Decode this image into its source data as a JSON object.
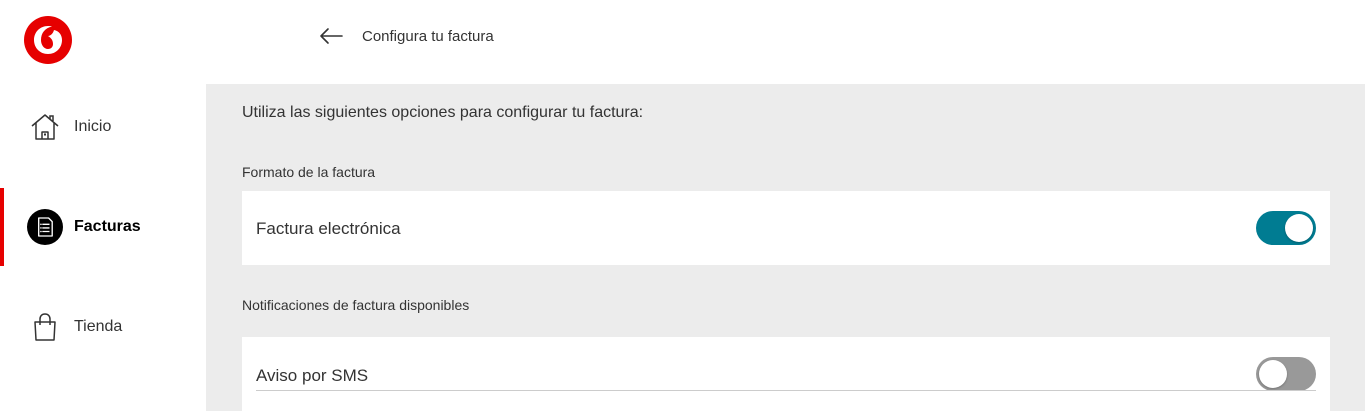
{
  "brand": {
    "color": "#e60000",
    "logo_icon": "vodafone-speechmark-icon"
  },
  "header": {
    "back_icon": "arrow-left-icon",
    "title": "Configura tu factura"
  },
  "sidebar": {
    "items": [
      {
        "label": "Inicio",
        "icon": "home-icon",
        "active": false
      },
      {
        "label": "Facturas",
        "icon": "bill-icon",
        "active": true
      },
      {
        "label": "Tienda",
        "icon": "shopping-bag-icon",
        "active": false
      }
    ]
  },
  "main": {
    "intro": "Utiliza las siguientes opciones para configurar tu factura:",
    "sections": [
      {
        "label": "Formato de la factura",
        "options": [
          {
            "label": "Factura electrónica",
            "enabled": true
          }
        ]
      },
      {
        "label": "Notificaciones de factura disponibles",
        "options": [
          {
            "label": "Aviso por SMS",
            "enabled": false
          }
        ]
      }
    ]
  },
  "colors": {
    "toggle_on": "#007c92",
    "toggle_off": "#999999",
    "background": "#ececec"
  }
}
